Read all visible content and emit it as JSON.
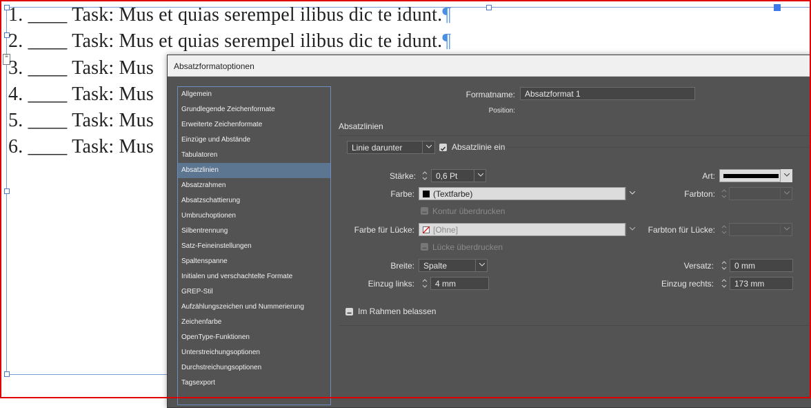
{
  "document": {
    "lines": [
      {
        "text": "1. ____ Task: Mus et quias serempel ilibus dic te idunt.",
        "pilcrow": "¶"
      },
      {
        "text": "2. ____ Task: Mus et quias serempel ilibus dic te idunt.",
        "pilcrow": "¶"
      },
      {
        "text": "3. ____ Task: Mus",
        "pilcrow": ""
      },
      {
        "text": "4. ____ Task: Mus",
        "pilcrow": ""
      },
      {
        "text": "5. ____ Task: Mus",
        "pilcrow": ""
      },
      {
        "text": "6. ____ Task: Mus",
        "pilcrow": ""
      }
    ]
  },
  "dialog": {
    "title": "Absatzformatoptionen",
    "sidebar": [
      {
        "label": "Allgemein",
        "selected": false
      },
      {
        "label": "Grundlegende Zeichenformate",
        "selected": false
      },
      {
        "label": "Erweiterte Zeichenformate",
        "selected": false
      },
      {
        "label": "Einzüge und Abstände",
        "selected": false
      },
      {
        "label": "Tabulatoren",
        "selected": false
      },
      {
        "label": "Absatzlinien",
        "selected": true
      },
      {
        "label": "Absatzrahmen",
        "selected": false
      },
      {
        "label": "Absatzschattierung",
        "selected": false
      },
      {
        "label": "Umbruchoptionen",
        "selected": false
      },
      {
        "label": "Silbentrennung",
        "selected": false
      },
      {
        "label": "Satz-Feineinstellungen",
        "selected": false
      },
      {
        "label": "Spaltenspanne",
        "selected": false
      },
      {
        "label": "Initialen und verschachtelte Formate",
        "selected": false
      },
      {
        "label": "GREP-Stil",
        "selected": false
      },
      {
        "label": "Aufzählungszeichen und Nummerierung",
        "selected": false
      },
      {
        "label": "Zeichenfarbe",
        "selected": false
      },
      {
        "label": "OpenType-Funktionen",
        "selected": false
      },
      {
        "label": "Unterstreichungsoptionen",
        "selected": false
      },
      {
        "label": "Durchstreichungsoptionen",
        "selected": false
      },
      {
        "label": "Tagsexport",
        "selected": false
      }
    ],
    "formatname_label": "Formatname:",
    "formatname_value": "Absatzformat 1",
    "position_label": "Position:",
    "section_title": "Absatzlinien",
    "line_type": "Linie darunter",
    "line_on_label": "Absatzlinie ein",
    "staerke_label": "Stärke:",
    "staerke_value": "0,6 Pt",
    "art_label": "Art:",
    "farbe_label": "Farbe:",
    "farbe_value": "(Textfarbe)",
    "farbton_label": "Farbton:",
    "kontur_label": "Kontur überdrucken",
    "luecke_farbe_label": "Farbe für Lücke:",
    "luecke_farbe_value": "[Ohne]",
    "luecke_farbton_label": "Farbton für Lücke:",
    "luecke_ueberdrucken_label": "Lücke überdrucken",
    "breite_label": "Breite:",
    "breite_value": "Spalte",
    "versatz_label": "Versatz:",
    "versatz_value": "0 mm",
    "einzug_links_label": "Einzug links:",
    "einzug_links_value": "4 mm",
    "einzug_rechts_label": "Einzug rechts:",
    "einzug_rechts_value": "173 mm",
    "rahmen_label": "Im Rahmen belassen"
  }
}
